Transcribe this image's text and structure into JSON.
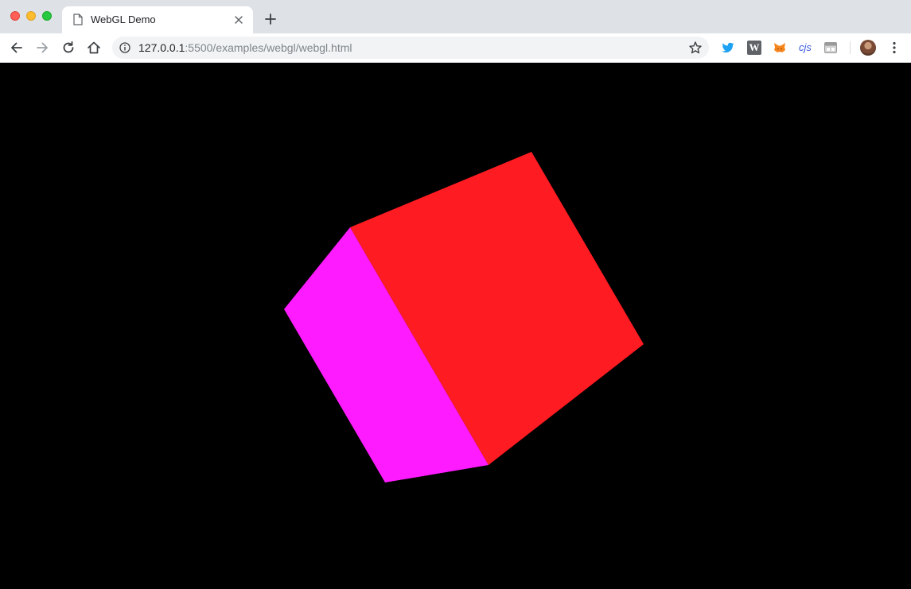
{
  "tab": {
    "title": "WebGL Demo"
  },
  "address": {
    "host": "127.0.0.1",
    "path": ":5500/examples/webgl/webgl.html"
  },
  "extensions": {
    "w_label": "W",
    "cjs_label": "cjs"
  },
  "scene": {
    "background": "#000000",
    "faces": [
      {
        "name": "front-face",
        "color": "#ff1b22"
      },
      {
        "name": "left-face",
        "color": "#ff1bff"
      }
    ]
  },
  "icons": [
    "page-icon",
    "close-tab-icon",
    "new-tab-icon",
    "back-icon",
    "forward-icon",
    "reload-icon",
    "home-icon",
    "info-icon",
    "bookmark-star-icon",
    "twitter-icon",
    "metamask-fox-icon",
    "extension-icon",
    "avatar",
    "menu-dots-icon"
  ]
}
